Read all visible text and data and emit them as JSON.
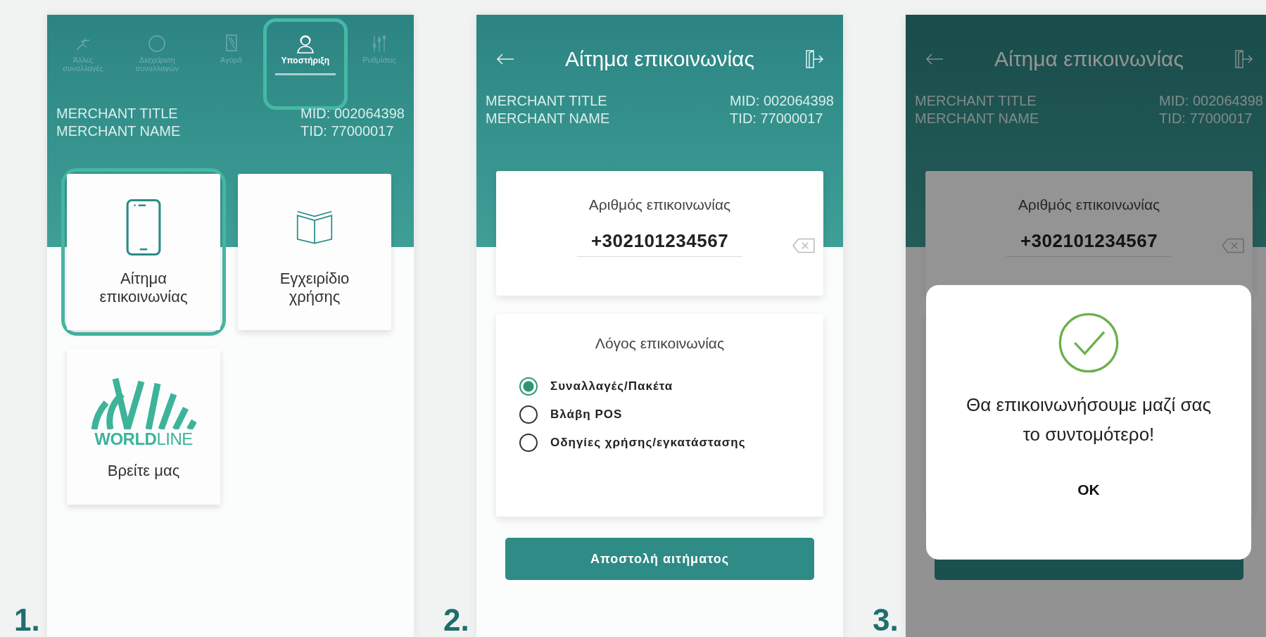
{
  "screens": [
    {
      "kind": "home",
      "step": "1.",
      "nav": [
        {
          "label": "Άλλες συναλλαγές",
          "selected": false,
          "highlighted": false
        },
        {
          "label": "Διαχείριση συναλλαγών",
          "selected": false,
          "highlighted": false
        },
        {
          "label": "Αγορά",
          "selected": false,
          "highlighted": false
        },
        {
          "label": "Υποστήριξη",
          "selected": true,
          "highlighted": true
        },
        {
          "label": "Ρυθμίσεις",
          "selected": false,
          "highlighted": false
        }
      ],
      "merchant": {
        "title": "MERCHANT TITLE",
        "name": "MERCHANT NAME",
        "mid": "MID: 002064398",
        "tid": "TID: 77000017"
      },
      "tiles": [
        {
          "kind": "phone",
          "label": "Αίτημα επικοινωνίας",
          "highlighted": true
        },
        {
          "kind": "book",
          "label": "Εγχειρίδιο χρήσης",
          "highlighted": false
        },
        {
          "kind": "logo",
          "logo_text": "**WORLD**LINE",
          "label": "Βρείτε μας",
          "highlighted": false
        }
      ]
    },
    {
      "kind": "form",
      "step": "2.",
      "title": "Αίτημα επικοινωνίας",
      "merchant": {
        "title": "MERCHANT TITLE",
        "name": "MERCHANT NAME",
        "mid": "MID: 002064398",
        "tid": "TID: 77000017"
      },
      "phone": {
        "label": "Αριθμός επικοινωνίας",
        "value": "+302101234567"
      },
      "reason": {
        "label": "Λόγος επικοινωνίας",
        "options": [
          {
            "label": "Συναλλαγές/Πακέτα",
            "selected": true
          },
          {
            "label": "Βλάβη POS",
            "selected": false
          },
          {
            "label": "Οδηγίες χρήσης/εγκατάστασης",
            "selected": false
          }
        ]
      },
      "submit": "Αποστολή αιτήματος"
    },
    {
      "kind": "dialog",
      "step": "3.",
      "title": "Αίτημα επικοινωνίας",
      "merchant": {
        "title": "MERCHANT TITLE",
        "name": "MERCHANT NAME",
        "mid": "MID: 002064398",
        "tid": "TID: 77000017"
      },
      "phone": {
        "label": "Αριθμός επικοινωνίας",
        "value": "+302101234567"
      },
      "dialog": {
        "message": "Θα επικοινωνήσουμε μαζί σας το συντομότερο!",
        "ok": "OK"
      }
    }
  ]
}
